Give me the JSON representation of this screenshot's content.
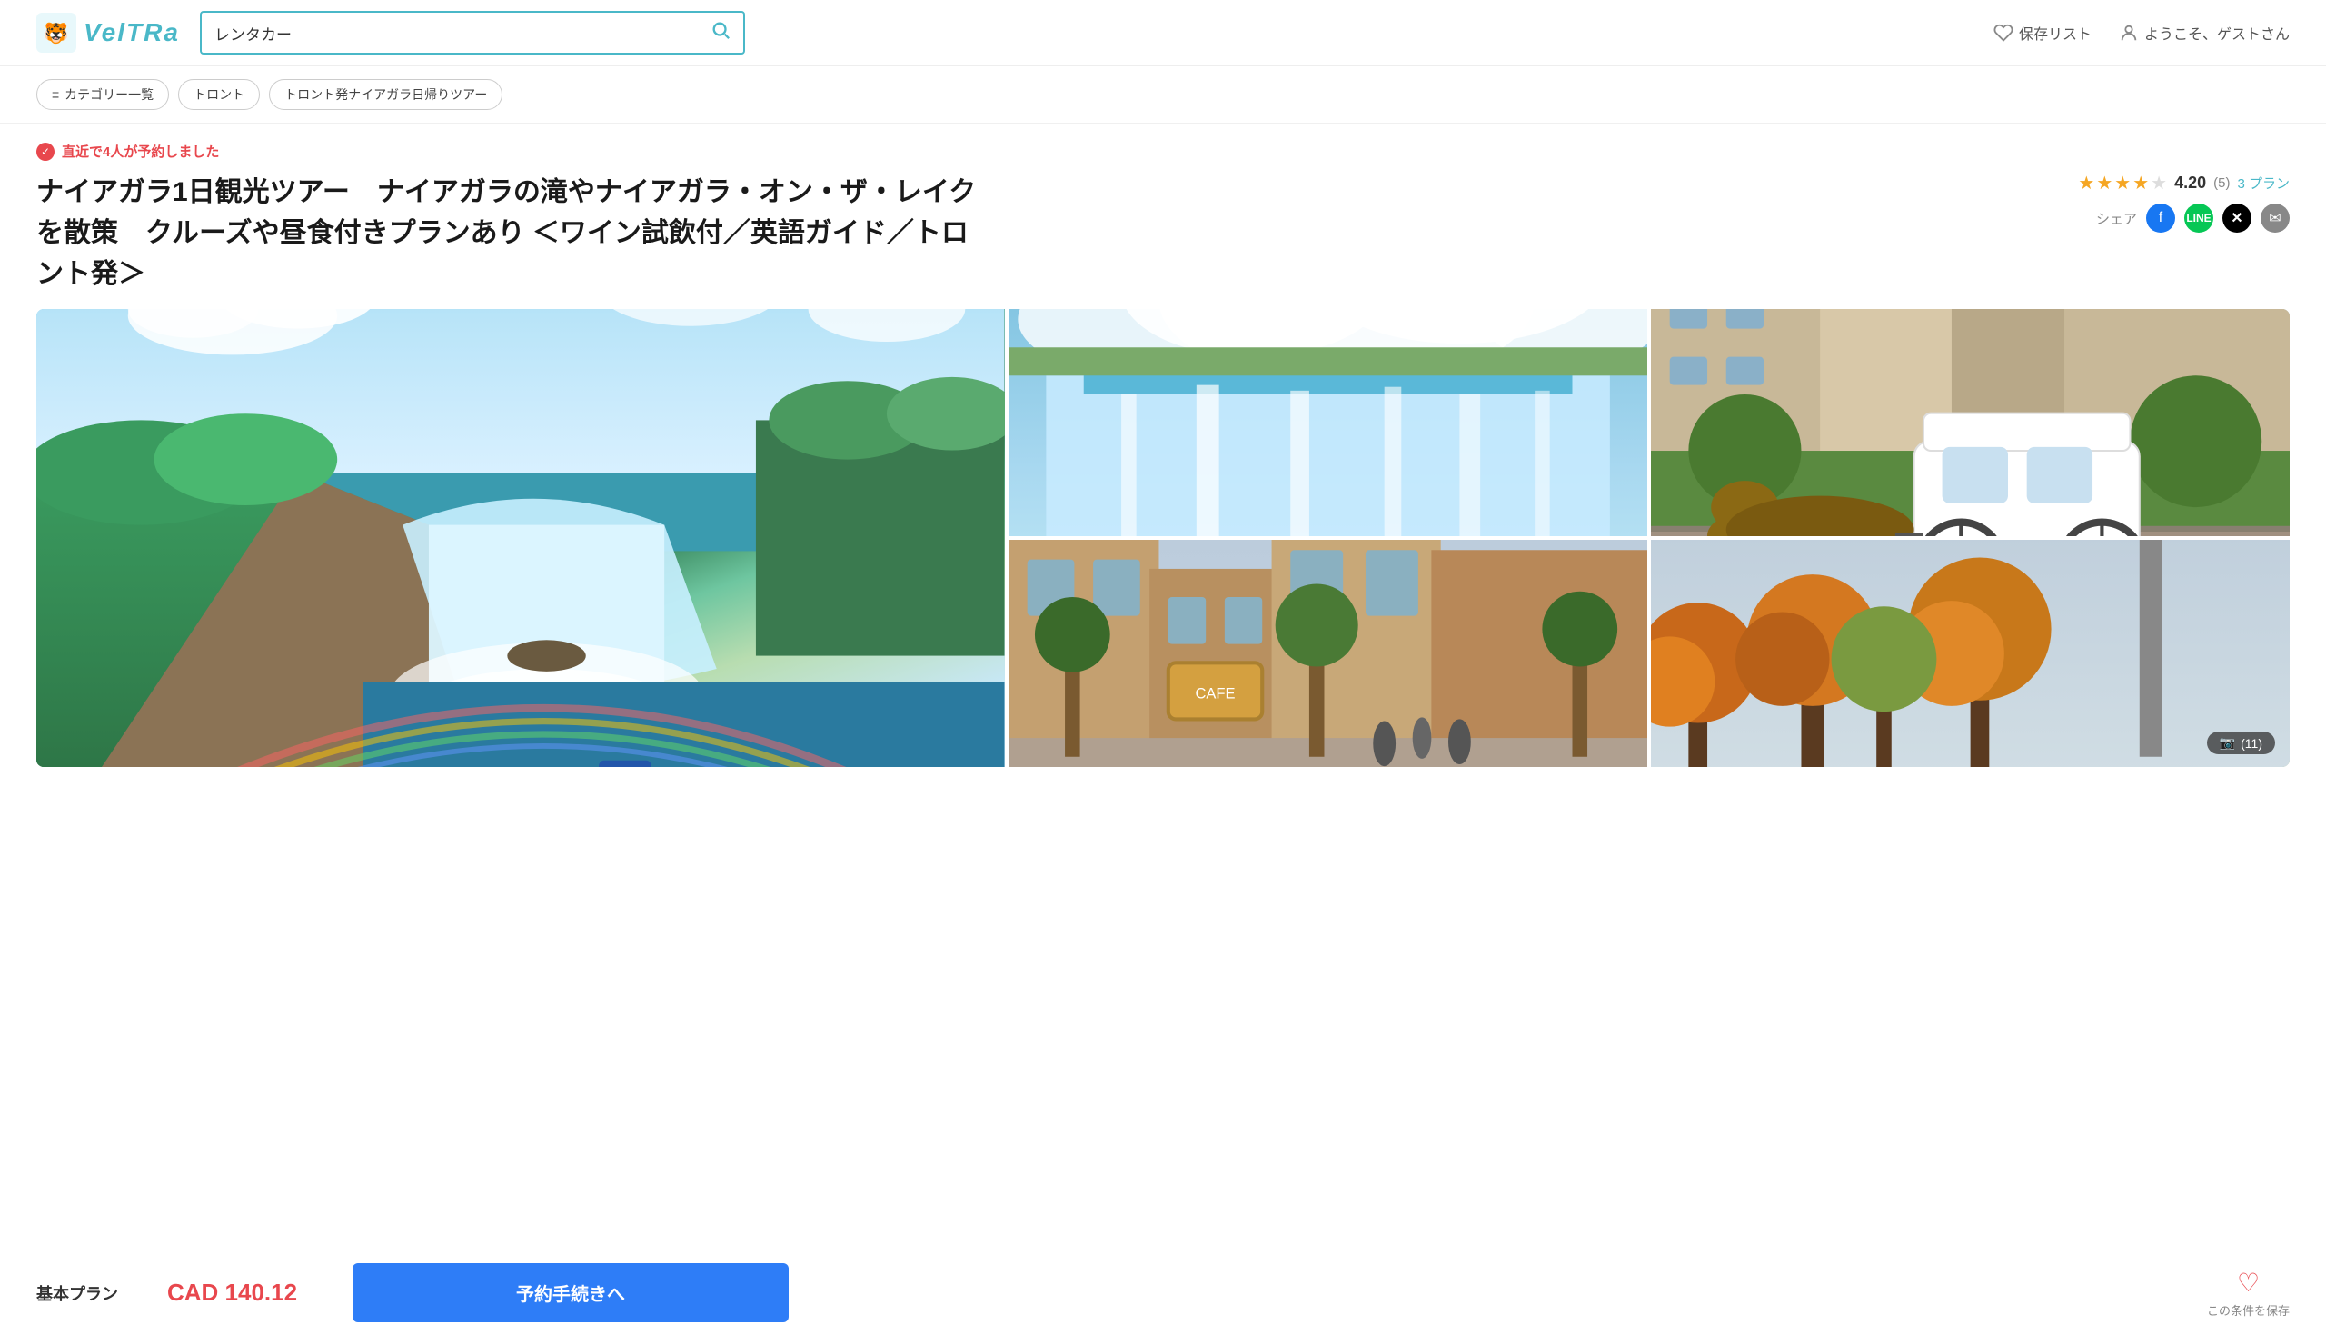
{
  "header": {
    "logo_text": "VelTRa",
    "search_placeholder": "レンタカー",
    "save_list_label": "保存リスト",
    "user_label": "ようこそ、ゲストさん"
  },
  "breadcrumb": {
    "items": [
      {
        "id": "category",
        "label": "カテゴリー一覧",
        "icon": "≡"
      },
      {
        "id": "toronto",
        "label": "トロント"
      },
      {
        "id": "niagara-tour",
        "label": "トロント発ナイアガラ日帰りツアー"
      }
    ]
  },
  "alert": {
    "text": "直近で4人が予約しました"
  },
  "tour": {
    "title": "ナイアガラ1日観光ツアー　ナイアガラの滝やナイアガラ・オン・ザ・レイクを散策　クルーズや昼食付きプランあり ＜ワイン試飲付／英語ガイド／トロント発＞",
    "rating_score": "4.20",
    "rating_count": "(5)",
    "plan_count": "3 プラン",
    "stars_filled": 4,
    "stars_total": 5
  },
  "share": {
    "label": "シェア"
  },
  "photos": {
    "count_label": "11",
    "camera_icon": "📷"
  },
  "bottom_bar": {
    "plan_label": "基本プラン",
    "price": "CAD 140.12",
    "book_button_label": "予約手続きへ",
    "save_label": "この条件を保存"
  }
}
